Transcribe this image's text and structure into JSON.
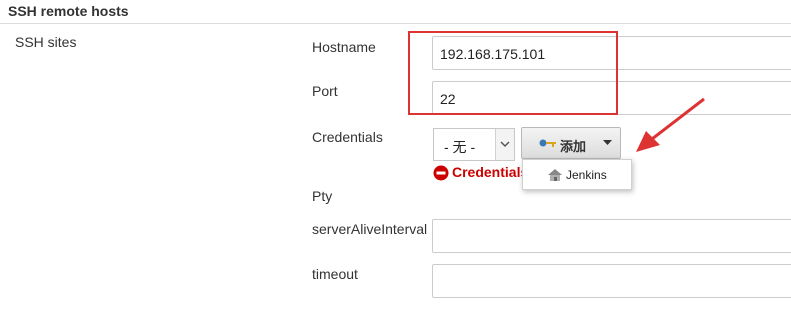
{
  "section": {
    "title": "SSH remote hosts"
  },
  "ssh_sites_label": "SSH sites",
  "fields": {
    "hostname": {
      "label": "Hostname",
      "value": "192.168.175.101"
    },
    "port": {
      "label": "Port",
      "value": "22"
    },
    "credentials": {
      "label": "Credentials",
      "selected": "- 无 -",
      "add_button_label": "添加",
      "menu_items": [
        "Jenkins"
      ],
      "error_text": "Credentials"
    },
    "pty": {
      "label": "Pty"
    },
    "server_alive_interval": {
      "label": "serverAliveInterval",
      "value": ""
    },
    "timeout": {
      "label": "timeout",
      "value": ""
    }
  },
  "colors": {
    "annotation_red": "#dd3333",
    "error_red": "#cc0000"
  }
}
